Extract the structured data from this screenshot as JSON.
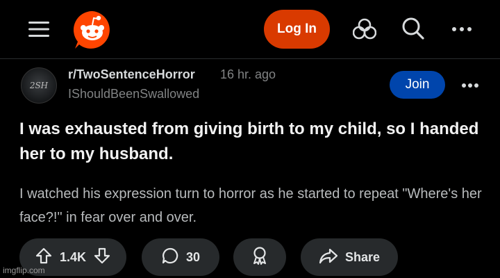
{
  "header": {
    "login_label": "Log In"
  },
  "post": {
    "subreddit": "r/TwoSentenceHorror",
    "time": "16 hr. ago",
    "username": "IShouldBeenSwallowed",
    "join_label": "Join",
    "avatar_text": "2SH",
    "title": "I was exhausted from giving birth to my child, so I handed her to my husband.",
    "body": "I watched his expression turn to horror as he started to repeat \"Where's her face?!\" in fear over and over."
  },
  "actions": {
    "vote_count": "1.4K",
    "comment_count": "30",
    "share_label": "Share"
  },
  "watermark": "imgflip.com",
  "colors": {
    "login_button": "#d93a00",
    "join_button": "#0045ac",
    "reddit_orange": "#ff4500",
    "pill_background": "#272a2c"
  }
}
